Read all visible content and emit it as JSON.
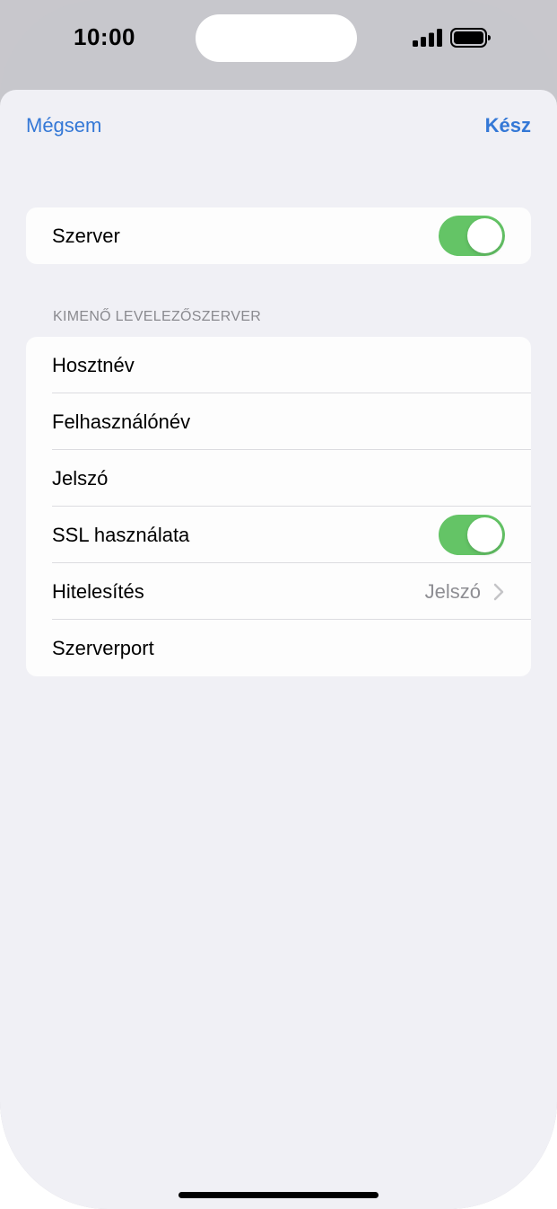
{
  "status_bar": {
    "time": "10:00"
  },
  "nav": {
    "cancel_label": "Mégsem",
    "done_label": "Kész"
  },
  "server_group": {
    "server_label": "Szerver",
    "server_toggle_on": true
  },
  "outgoing": {
    "header": "KIMENŐ LEVELEZŐSZERVER",
    "rows": [
      {
        "label": "Hosztnév"
      },
      {
        "label": "Felhasználónév"
      },
      {
        "label": "Jelszó"
      },
      {
        "label": "SSL használata",
        "toggle_on": true
      },
      {
        "label": "Hitelesítés",
        "value": "Jelszó"
      },
      {
        "label": "Szerverport"
      }
    ]
  },
  "colors": {
    "accent": "#3478d6",
    "toggle_on": "#64c466",
    "background": "#f0f0f5"
  }
}
